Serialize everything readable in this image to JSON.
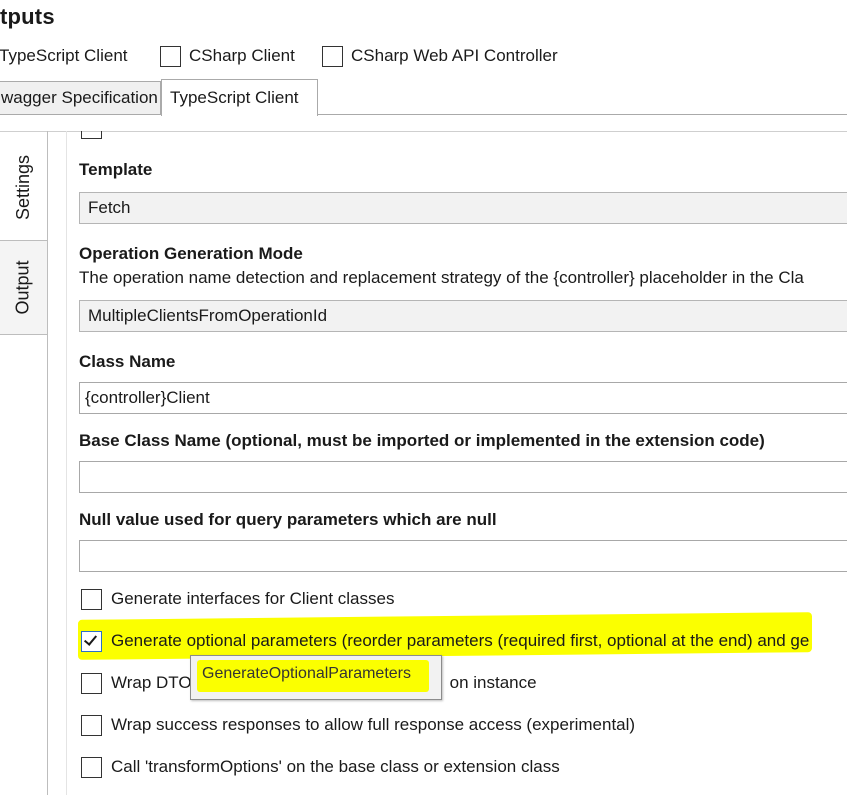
{
  "section": {
    "title": "tputs"
  },
  "output_types": [
    {
      "label": "TypeScript Client",
      "checked": true
    },
    {
      "label": "CSharp Client",
      "checked": false
    },
    {
      "label": "CSharp Web API Controller",
      "checked": false
    }
  ],
  "tabs": [
    {
      "label": "wagger Specification",
      "active": false
    },
    {
      "label": "TypeScript Client",
      "active": true
    }
  ],
  "side_tabs": {
    "settings": "Settings",
    "output": "Output"
  },
  "form": {
    "template": {
      "label": "Template",
      "value": "Fetch"
    },
    "operation_mode": {
      "label": "Operation Generation Mode",
      "description": "The operation name detection and replacement strategy of the {controller} placeholder in the Cla",
      "value": "MultipleClientsFromOperationId"
    },
    "class_name": {
      "label": "Class Name",
      "value": "{controller}Client"
    },
    "base_class_name": {
      "label": "Base Class Name (optional, must be imported or implemented in the extension code)",
      "value": ""
    },
    "null_value": {
      "label": "Null value used for query parameters which are null",
      "value": ""
    }
  },
  "options": [
    {
      "label": "Generate interfaces for Client classes",
      "checked": false
    },
    {
      "label": "Generate optional parameters (reorder parameters (required first, optional at the end) and ge",
      "checked": true
    },
    {
      "label": "Wrap DTO",
      "label_tail": "on instance",
      "checked": false
    },
    {
      "label": "Wrap success responses to allow full response access (experimental)",
      "checked": false
    },
    {
      "label": "Call 'transformOptions' on the base class or extension class",
      "checked": false
    }
  ],
  "tooltip": {
    "text": "GenerateOptionalParameters"
  },
  "colors": {
    "highlight": "#fbff00",
    "checkbox_focus": "#2a6fc9"
  }
}
